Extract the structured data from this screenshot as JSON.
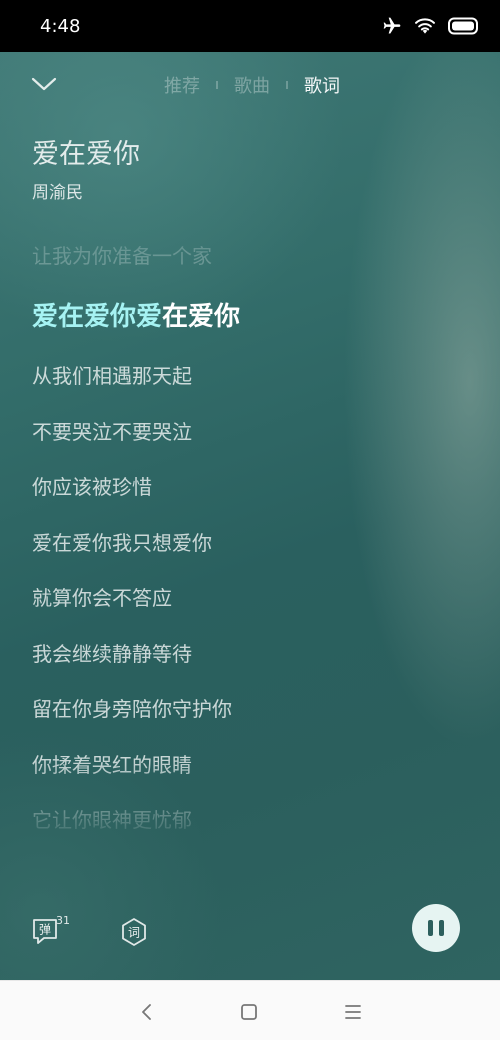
{
  "status_bar": {
    "time": "4:48",
    "icons": [
      "airplane-icon",
      "wifi-icon",
      "battery-icon"
    ]
  },
  "header": {
    "collapse_icon": "chevron-down-icon",
    "tabs": [
      {
        "label": "推荐",
        "active": false
      },
      {
        "label": "歌曲",
        "active": false
      },
      {
        "label": "歌词",
        "active": true
      }
    ]
  },
  "song": {
    "title": "爱在爱你",
    "artist": "周渝民"
  },
  "lyrics": {
    "past": "让我为你准备一个家",
    "current_sung": "爱在爱你爱",
    "current_rest": "在爱你",
    "upcoming": [
      "从我们相遇那天起",
      "不要哭泣不要哭泣",
      "你应该被珍惜",
      "爱在爱你我只想爱你",
      "就算你会不答应",
      "我会继续静静等待",
      "留在你身旁陪你守护你",
      "你揉着哭红的眼睛",
      "它让你眼神更忧郁"
    ]
  },
  "controls": {
    "danmaku_icon_char": "弹",
    "danmaku_count": "31",
    "lyric_icon_char": "词",
    "play_state": "playing"
  },
  "colors": {
    "accent_sung": "#a6f3f3",
    "background": "#2c6461"
  }
}
